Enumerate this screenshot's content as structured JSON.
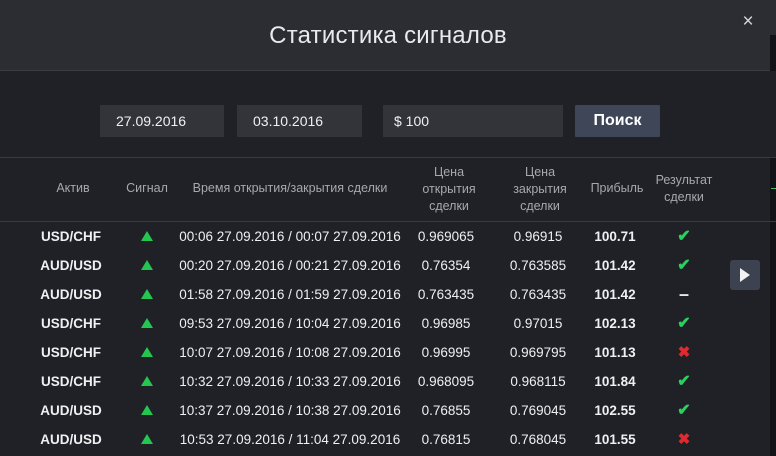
{
  "header": {
    "title": "Статистика сигналов",
    "close_symbol": "×"
  },
  "filters": {
    "date_from": "27.09.2016",
    "date_to": "03.10.2016",
    "amount": "$ 100",
    "search_label": "Поиск"
  },
  "table": {
    "columns": [
      "Актив",
      "Сигнал",
      "Время открытия/закрытия сделки",
      "Цена открытия сделки",
      "Цена закрытия сделки",
      "Прибыль",
      "Результат сделки"
    ],
    "rows": [
      {
        "asset": "USD/CHF",
        "signal": "up",
        "time": "00:06 27.09.2016 / 00:07 27.09.2016",
        "open": "0.969065",
        "close": "0.96915",
        "profit": "100.71",
        "result": "win"
      },
      {
        "asset": "AUD/USD",
        "signal": "up",
        "time": "00:20 27.09.2016 / 00:21 27.09.2016",
        "open": "0.76354",
        "close": "0.763585",
        "profit": "101.42",
        "result": "win"
      },
      {
        "asset": "AUD/USD",
        "signal": "up",
        "time": "01:58 27.09.2016 / 01:59 27.09.2016",
        "open": "0.763435",
        "close": "0.763435",
        "profit": "101.42",
        "result": "draw"
      },
      {
        "asset": "USD/CHF",
        "signal": "up",
        "time": "09:53 27.09.2016 / 10:04 27.09.2016",
        "open": "0.96985",
        "close": "0.97015",
        "profit": "102.13",
        "result": "win"
      },
      {
        "asset": "USD/CHF",
        "signal": "up",
        "time": "10:07 27.09.2016 / 10:08 27.09.2016",
        "open": "0.96995",
        "close": "0.969795",
        "profit": "101.13",
        "result": "loss"
      },
      {
        "asset": "USD/CHF",
        "signal": "up",
        "time": "10:32 27.09.2016 / 10:33 27.09.2016",
        "open": "0.968095",
        "close": "0.968115",
        "profit": "101.84",
        "result": "win"
      },
      {
        "asset": "AUD/USD",
        "signal": "up",
        "time": "10:37 27.09.2016 / 10:38 27.09.2016",
        "open": "0.76855",
        "close": "0.769045",
        "profit": "102.55",
        "result": "win"
      },
      {
        "asset": "AUD/USD",
        "signal": "up",
        "time": "10:53 27.09.2016 / 11:04 27.09.2016",
        "open": "0.76815",
        "close": "0.768045",
        "profit": "101.55",
        "result": "loss"
      }
    ]
  },
  "icons": {
    "signal_up": "triangle-up-icon",
    "win": "checkmark-icon",
    "loss": "cross-icon",
    "draw": "dash-icon",
    "next": "play-right-icon"
  },
  "colors": {
    "background": "#202126",
    "header_background": "#2c2d33",
    "field_background": "#33343a",
    "button_background": "#3f4657",
    "signal_up": "#23c64f",
    "win": "#2bd15f",
    "loss": "#e02a30"
  }
}
